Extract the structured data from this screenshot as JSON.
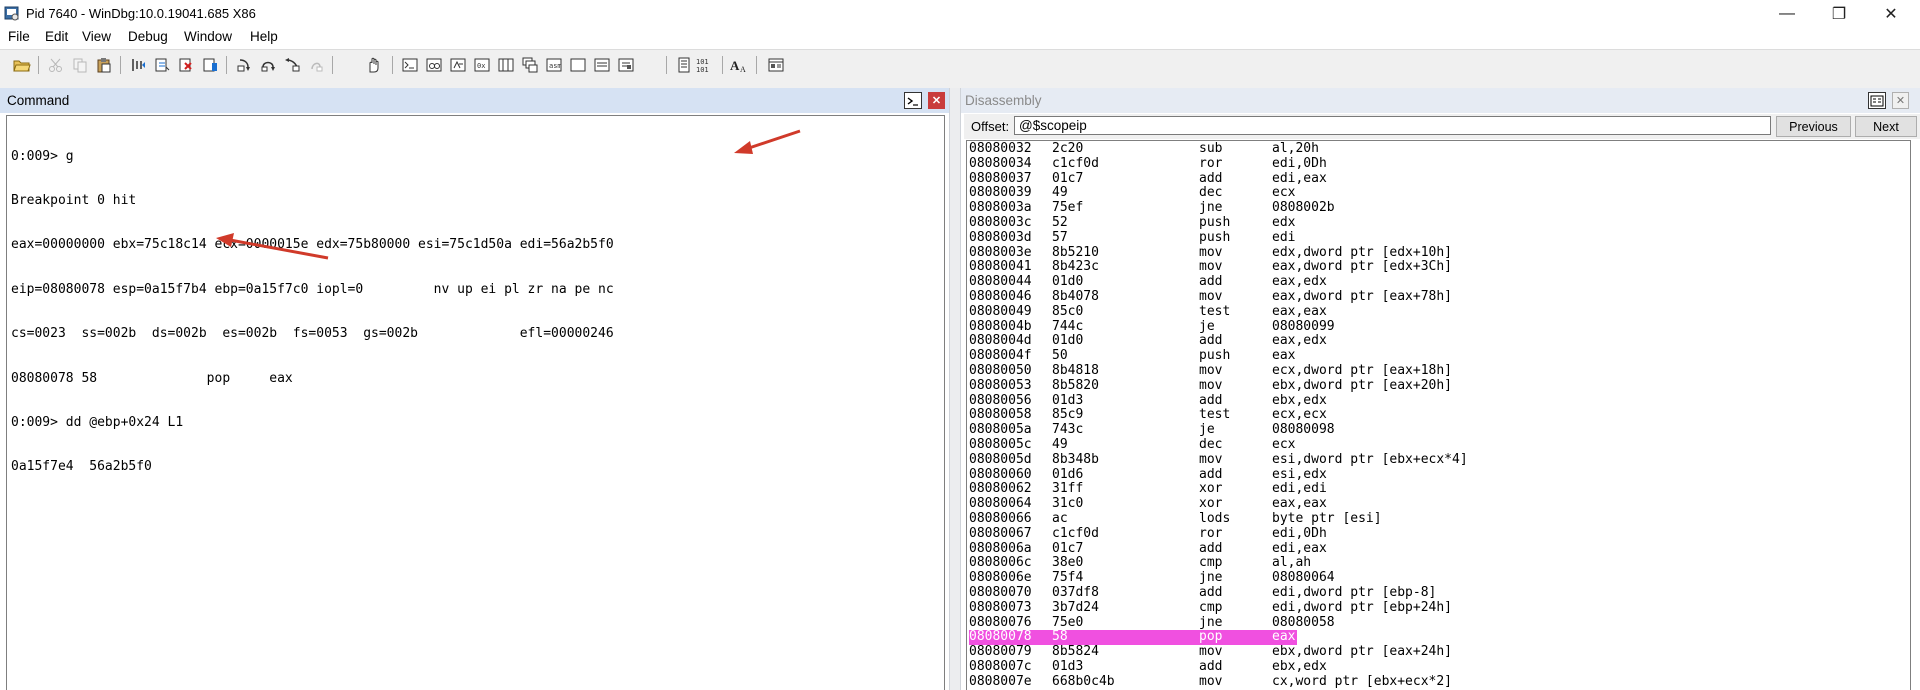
{
  "window": {
    "title": "Pid 7640 - WinDbg:10.0.19041.685 X86",
    "minimize": "—",
    "restore": "❐",
    "close": "✕"
  },
  "menu": {
    "items": [
      "File",
      "Edit",
      "View",
      "Debug",
      "Window",
      "Help"
    ]
  },
  "toolbar": {
    "icons": [
      "open-icon",
      "cut-icon",
      "copy-icon",
      "paste-icon",
      "go-icon",
      "restart-icon",
      "stop-debugging-icon",
      "break-icon",
      "step-into-icon",
      "step-over-icon",
      "step-out-icon",
      "run-to-cursor-icon",
      "hand-icon",
      "command-window-icon",
      "watch-window-icon",
      "locals-window-icon",
      "registers-window-icon",
      "memory-window-icon",
      "call-stack-icon",
      "disassembly-window-icon",
      "scratch-pad-icon",
      "processes-threads-icon",
      "source-mode-icon",
      "hex-mode-icon",
      "font-icon",
      "options-icon"
    ]
  },
  "command": {
    "title": "Command",
    "lines": [
      "0:009> g",
      "Breakpoint 0 hit",
      "eax=00000000 ebx=75c18c14 ecx=0000015e edx=75b80000 esi=75c1d50a edi=56a2b5f0",
      "eip=08080078 esp=0a15f7b4 ebp=0a15f7c0 iopl=0         nv up ei pl zr na pe nc",
      "cs=0023  ss=002b  ds=002b  es=002b  fs=0053  gs=002b             efl=00000246",
      "08080078 58              pop     eax",
      "0:009> dd @ebp+0x24 L1",
      "0a15f7e4  56a2b5f0"
    ]
  },
  "disassembly": {
    "title": "Disassembly",
    "offset_label": "Offset:",
    "offset_value": "@$scopeip",
    "previous_label": "Previous",
    "next_label": "Next",
    "highlight_color": "#f050e0",
    "rows": [
      {
        "addr": "08080032",
        "bytes": "2c20",
        "mnem": "sub",
        "ops": "al,20h"
      },
      {
        "addr": "08080034",
        "bytes": "c1cf0d",
        "mnem": "ror",
        "ops": "edi,0Dh"
      },
      {
        "addr": "08080037",
        "bytes": "01c7",
        "mnem": "add",
        "ops": "edi,eax"
      },
      {
        "addr": "08080039",
        "bytes": "49",
        "mnem": "dec",
        "ops": "ecx"
      },
      {
        "addr": "0808003a",
        "bytes": "75ef",
        "mnem": "jne",
        "ops": "0808002b"
      },
      {
        "addr": "0808003c",
        "bytes": "52",
        "mnem": "push",
        "ops": "edx"
      },
      {
        "addr": "0808003d",
        "bytes": "57",
        "mnem": "push",
        "ops": "edi"
      },
      {
        "addr": "0808003e",
        "bytes": "8b5210",
        "mnem": "mov",
        "ops": "edx,dword ptr [edx+10h]"
      },
      {
        "addr": "08080041",
        "bytes": "8b423c",
        "mnem": "mov",
        "ops": "eax,dword ptr [edx+3Ch]"
      },
      {
        "addr": "08080044",
        "bytes": "01d0",
        "mnem": "add",
        "ops": "eax,edx"
      },
      {
        "addr": "08080046",
        "bytes": "8b4078",
        "mnem": "mov",
        "ops": "eax,dword ptr [eax+78h]"
      },
      {
        "addr": "08080049",
        "bytes": "85c0",
        "mnem": "test",
        "ops": "eax,eax"
      },
      {
        "addr": "0808004b",
        "bytes": "744c",
        "mnem": "je",
        "ops": "08080099"
      },
      {
        "addr": "0808004d",
        "bytes": "01d0",
        "mnem": "add",
        "ops": "eax,edx"
      },
      {
        "addr": "0808004f",
        "bytes": "50",
        "mnem": "push",
        "ops": "eax"
      },
      {
        "addr": "08080050",
        "bytes": "8b4818",
        "mnem": "mov",
        "ops": "ecx,dword ptr [eax+18h]"
      },
      {
        "addr": "08080053",
        "bytes": "8b5820",
        "mnem": "mov",
        "ops": "ebx,dword ptr [eax+20h]"
      },
      {
        "addr": "08080056",
        "bytes": "01d3",
        "mnem": "add",
        "ops": "ebx,edx"
      },
      {
        "addr": "08080058",
        "bytes": "85c9",
        "mnem": "test",
        "ops": "ecx,ecx"
      },
      {
        "addr": "0808005a",
        "bytes": "743c",
        "mnem": "je",
        "ops": "08080098"
      },
      {
        "addr": "0808005c",
        "bytes": "49",
        "mnem": "dec",
        "ops": "ecx"
      },
      {
        "addr": "0808005d",
        "bytes": "8b348b",
        "mnem": "mov",
        "ops": "esi,dword ptr [ebx+ecx*4]"
      },
      {
        "addr": "08080060",
        "bytes": "01d6",
        "mnem": "add",
        "ops": "esi,edx"
      },
      {
        "addr": "08080062",
        "bytes": "31ff",
        "mnem": "xor",
        "ops": "edi,edi"
      },
      {
        "addr": "08080064",
        "bytes": "31c0",
        "mnem": "xor",
        "ops": "eax,eax"
      },
      {
        "addr": "08080066",
        "bytes": "ac",
        "mnem": "lods",
        "ops": "byte ptr [esi]"
      },
      {
        "addr": "08080067",
        "bytes": "c1cf0d",
        "mnem": "ror",
        "ops": "edi,0Dh"
      },
      {
        "addr": "0808006a",
        "bytes": "01c7",
        "mnem": "add",
        "ops": "edi,eax"
      },
      {
        "addr": "0808006c",
        "bytes": "38e0",
        "mnem": "cmp",
        "ops": "al,ah"
      },
      {
        "addr": "0808006e",
        "bytes": "75f4",
        "mnem": "jne",
        "ops": "08080064"
      },
      {
        "addr": "08080070",
        "bytes": "037df8",
        "mnem": "add",
        "ops": "edi,dword ptr [ebp-8]"
      },
      {
        "addr": "08080073",
        "bytes": "3b7d24",
        "mnem": "cmp",
        "ops": "edi,dword ptr [ebp+24h]"
      },
      {
        "addr": "08080076",
        "bytes": "75e0",
        "mnem": "jne",
        "ops": "08080058"
      },
      {
        "addr": "08080078",
        "bytes": "58",
        "mnem": "pop",
        "ops": "eax",
        "current": true
      },
      {
        "addr": "08080079",
        "bytes": "8b5824",
        "mnem": "mov",
        "ops": "ebx,dword ptr [eax+24h]"
      },
      {
        "addr": "0808007c",
        "bytes": "01d3",
        "mnem": "add",
        "ops": "ebx,edx"
      },
      {
        "addr": "0808007e",
        "bytes": "668b0c4b",
        "mnem": "mov",
        "ops": "cx,word ptr [ebx+ecx*2]"
      }
    ]
  },
  "annotations": {
    "arrow_color": "#d03a2a"
  }
}
